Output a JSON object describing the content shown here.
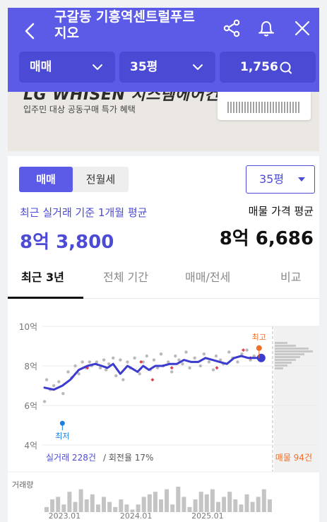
{
  "header": {
    "title": "구갈동 기흥역센트럴푸르지오",
    "filters": {
      "trade_type": "매매",
      "size": "35평",
      "listing_count": "1,756"
    }
  },
  "banner": {
    "brand": "LG WHISEN 시스템에어컨",
    "subtitle": "입주민 대상 공동구매 특가 혜택"
  },
  "segment": {
    "active": "매매",
    "inactive": "전월세"
  },
  "size_select": "35평",
  "summary": {
    "actual_label": "최근 실거래 기준 1개월 평균",
    "actual_value": "8억 3,800",
    "listing_label": "매물 가격 평균",
    "listing_value": "8억 6,686"
  },
  "tabs": [
    "최근 3년",
    "전체 기간",
    "매매/전세",
    "비교"
  ],
  "chart_data": {
    "type": "line",
    "y_ticks": [
      "10억",
      "8억",
      "6억",
      "4억"
    ],
    "ylim": [
      4,
      10
    ],
    "x_ticks": [
      "2023.01",
      "2024.01",
      "2025.01"
    ],
    "x_tick_positions": [
      2023.0,
      2024.0,
      2025.0
    ],
    "xlim": [
      2022.7,
      2025.88
    ],
    "series": [
      {
        "x": [
          2022.72,
          2022.85,
          2022.97,
          2023.08,
          2023.2,
          2023.32,
          2023.43,
          2023.52,
          2023.6,
          2023.68,
          2023.78,
          2023.88,
          2023.93,
          2024.02,
          2024.1,
          2024.18,
          2024.27,
          2024.37,
          2024.47,
          2024.57,
          2024.67,
          2024.77,
          2024.87,
          2024.97,
          2025.07,
          2025.17,
          2025.27,
          2025.37,
          2025.47,
          2025.57,
          2025.67,
          2025.75
        ],
        "values": [
          6.9,
          6.8,
          7.0,
          7.3,
          7.8,
          8.0,
          8.1,
          8.0,
          7.9,
          8.1,
          7.6,
          8.0,
          7.9,
          7.7,
          8.0,
          7.8,
          8.0,
          8.0,
          8.1,
          8.1,
          8.3,
          8.2,
          8.2,
          8.4,
          8.3,
          8.2,
          8.1,
          8.4,
          8.5,
          8.4,
          8.4,
          8.4
        ]
      }
    ],
    "annotations": {
      "max_label": "최고",
      "max_value": 8.9,
      "max_x": 2025.72,
      "min_label": "최저",
      "min_value": 5.1,
      "min_x": 2022.97
    },
    "scatter": {
      "x": [
        2022.72,
        2022.75,
        2022.8,
        2022.85,
        2022.92,
        2022.98,
        2023.05,
        2023.1,
        2023.15,
        2023.2,
        2023.25,
        2023.3,
        2023.35,
        2023.38,
        2023.45,
        2023.5,
        2023.55,
        2023.58,
        2023.62,
        2023.68,
        2023.72,
        2023.78,
        2023.82,
        2023.88,
        2023.92,
        2023.98,
        2024.05,
        2024.1,
        2024.15,
        2024.2,
        2024.25,
        2024.3,
        2024.35,
        2024.38,
        2024.45,
        2024.5,
        2024.55,
        2024.6,
        2024.65,
        2024.7,
        2024.75,
        2024.82,
        2024.9,
        2024.95,
        2025.02,
        2025.08,
        2025.12,
        2025.18,
        2025.22,
        2025.3,
        2025.35,
        2025.42,
        2025.48,
        2025.55,
        2025.6,
        2025.65
      ],
      "values": [
        6.2,
        7.3,
        6.8,
        7.0,
        7.2,
        6.6,
        7.7,
        7.4,
        8.0,
        7.6,
        8.2,
        7.9,
        8.2,
        8.0,
        8.2,
        7.9,
        8.3,
        7.8,
        8.1,
        8.4,
        7.5,
        8.3,
        7.3,
        8.2,
        7.9,
        8.4,
        7.6,
        8.2,
        8.5,
        7.8,
        8.3,
        7.9,
        8.6,
        8.0,
        8.2,
        7.7,
        8.5,
        8.3,
        8.1,
        8.7,
        7.9,
        8.4,
        8.0,
        8.6,
        8.2,
        7.8,
        8.5,
        8.3,
        8.1,
        8.7,
        8.4,
        8.2,
        8.6,
        8.8,
        8.3,
        8.5
      ]
    },
    "highlight_points": {
      "x": [
        2023.32,
        2024.07,
        2024.23,
        2024.5,
        2025.13,
        2025.5,
        2025.6
      ],
      "values": [
        7.9,
        8.2,
        7.3,
        7.9,
        7.9,
        8.8,
        8.4
      ]
    },
    "listing_histogram": [
      0.3,
      0.5,
      0.8,
      0.9,
      0.7,
      0.6,
      0.5,
      0.4,
      0.3,
      0.2
    ],
    "volume": [
      0.2,
      0.5,
      0.6,
      0.3,
      0.8,
      0.4,
      0.9,
      0.5,
      0.7,
      0.3,
      0.6,
      0.4,
      0.2,
      0.5,
      0.3,
      0.1,
      0.3,
      0.6,
      0.7,
      0.8,
      0.5,
      0.9,
      0.3,
      1.0,
      0.6,
      0.2,
      0.5,
      0.8,
      0.7,
      0.9,
      0.4,
      0.6,
      0.8,
      0.5,
      0.3,
      0.7,
      0.4,
      0.6,
      0.9,
      0.5
    ],
    "actual_label": "실거래 228건",
    "turnover_label": "/ 회전율 17%",
    "listing_label": "매물 94건",
    "volume_label": "거래량"
  },
  "colors": {
    "primary": "#5b5be8",
    "line": "#3b3bcf",
    "max": "#f0702a",
    "min": "#1a7fe0",
    "highlight": "#e0404a"
  }
}
